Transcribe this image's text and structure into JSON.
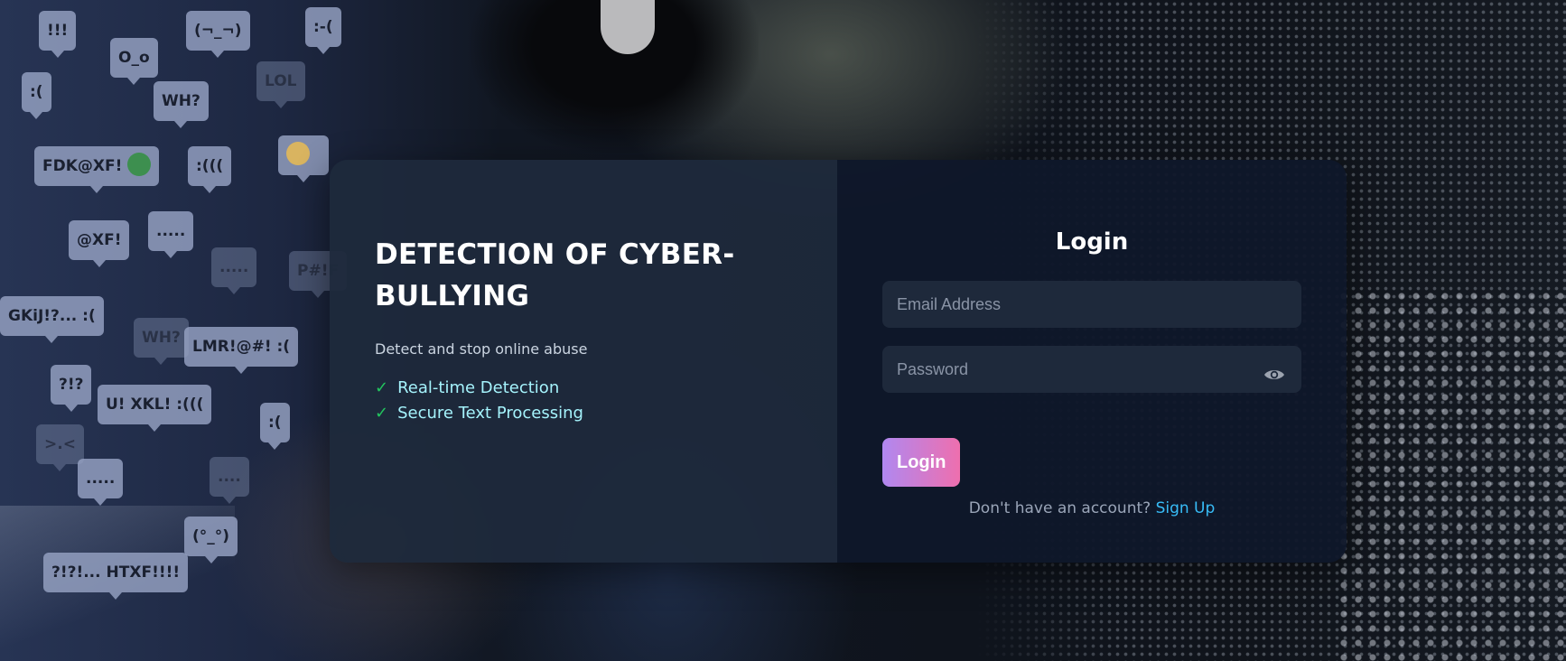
{
  "background": {
    "bubbles": [
      {
        "text": "!!!",
        "dim": false
      },
      {
        "text": "(¬_¬)",
        "dim": false
      },
      {
        "text": ":-(",
        "dim": false
      },
      {
        "text": "O_o",
        "dim": false
      },
      {
        "text": ":(",
        "dim": false
      },
      {
        "text": "WH?",
        "dim": false
      },
      {
        "text": "LOL",
        "dim": true
      },
      {
        "text": "FDK@XF!",
        "dim": false,
        "emoji": "green-face-icon"
      },
      {
        "text": ":(((",
        "dim": false
      },
      {
        "text": "",
        "dim": false,
        "emoji": "frown-face-icon"
      },
      {
        "text": "@XF!",
        "dim": false
      },
      {
        "text": ".....",
        "dim": false
      },
      {
        "text": ".....",
        "dim": true
      },
      {
        "text": "P#!F",
        "dim": true
      },
      {
        "text": "GKiJ!?... :(",
        "dim": false
      },
      {
        "text": "WH?",
        "dim": true
      },
      {
        "text": "LMR!@#!    :(",
        "dim": false
      },
      {
        "text": "?!?",
        "dim": false
      },
      {
        "text": "U! XKL! :(((",
        "dim": false
      },
      {
        "text": ":(",
        "dim": false
      },
      {
        "text": ">.<",
        "dim": true
      },
      {
        "text": ".....",
        "dim": false
      },
      {
        "text": "....",
        "dim": true
      },
      {
        "text": "(°_°)",
        "dim": false
      },
      {
        "text": "?!?!... HTXF!!!!",
        "dim": false
      }
    ]
  },
  "hero": {
    "title": "DETECTION OF CYBER-BULLYING",
    "subtitle": "Detect and stop online abuse",
    "check_glyph": "✓",
    "features": [
      "Real-time Detection",
      "Secure Text Processing"
    ]
  },
  "login": {
    "title": "Login",
    "email_placeholder": "Email Address",
    "password_placeholder": "Password",
    "toggle_icon": "eye-icon",
    "button_label": "Login",
    "signup_prompt": "Don't have an account?",
    "signup_link": "Sign Up"
  },
  "colors": {
    "accent_gradient_start": "#b088f0",
    "accent_gradient_end": "#ee6fae",
    "feature_text": "#a5f3fc",
    "check": "#22c55e",
    "link": "#38bdf8"
  }
}
